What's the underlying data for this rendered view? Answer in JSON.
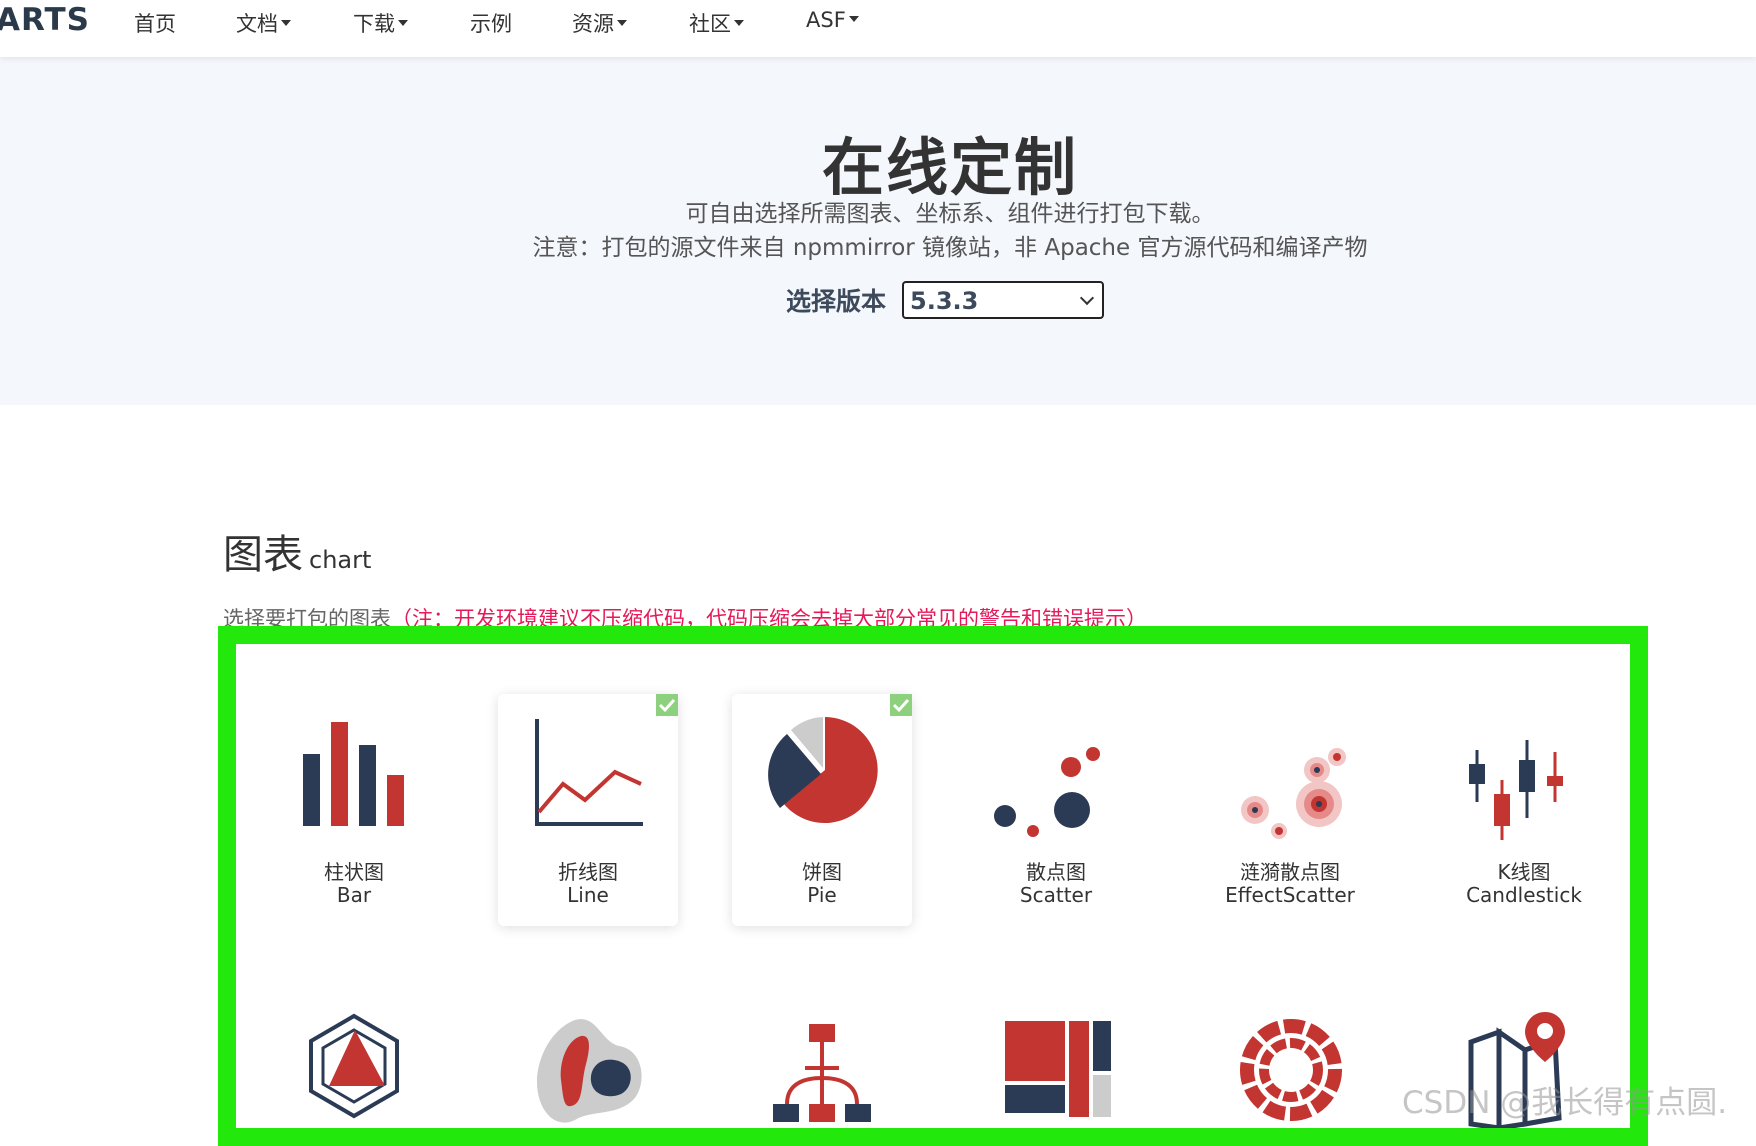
{
  "navbar": {
    "logo": "ARTS",
    "items": [
      {
        "label": "首页",
        "dropdown": false
      },
      {
        "label": "文档",
        "dropdown": true
      },
      {
        "label": "下载",
        "dropdown": true
      },
      {
        "label": "示例",
        "dropdown": false
      },
      {
        "label": "资源",
        "dropdown": true
      },
      {
        "label": "社区",
        "dropdown": true
      },
      {
        "label": "ASF",
        "dropdown": true
      }
    ]
  },
  "hero": {
    "title": "在线定制",
    "desc_line1": "可自由选择所需图表、坐标系、组件进行打包下载。",
    "desc_line2": "注意：打包的源文件来自 npmmirror 镜像站，非 Apache 官方源代码和编译产物",
    "version_label": "选择版本",
    "version_value": "5.3.3"
  },
  "chart_section": {
    "title_zh": "图表",
    "title_en": "chart",
    "subtitle": "选择要打包的图表",
    "note": "（注：开发环境建议不压缩代码，代码压缩会去掉大部分常见的警告和错误提示）",
    "cards": [
      {
        "label_zh": "柱状图",
        "label_en": "Bar",
        "selected": false,
        "icon": "bar-chart-icon"
      },
      {
        "label_zh": "折线图",
        "label_en": "Line",
        "selected": true,
        "icon": "line-chart-icon"
      },
      {
        "label_zh": "饼图",
        "label_en": "Pie",
        "selected": true,
        "icon": "pie-chart-icon"
      },
      {
        "label_zh": "散点图",
        "label_en": "Scatter",
        "selected": false,
        "icon": "scatter-chart-icon"
      },
      {
        "label_zh": "涟漪散点图",
        "label_en": "EffectScatter",
        "selected": false,
        "icon": "effect-scatter-chart-icon"
      },
      {
        "label_zh": "K线图",
        "label_en": "Candlestick",
        "selected": false,
        "icon": "candlestick-chart-icon"
      }
    ],
    "row2_icons": [
      "radar-chart-icon",
      "map-chart-icon",
      "tree-chart-icon",
      "treemap-chart-icon",
      "sunburst-chart-icon",
      "geo-map-icon"
    ]
  },
  "colors": {
    "navy": "#2b3a55",
    "red": "#c23531",
    "highlight_green": "#22e80c",
    "check_green": "#8dd17e",
    "note_pink": "#e6195a",
    "hero_bg": "#f4f7fc"
  },
  "watermark": "CSDN @我长得有点圆."
}
